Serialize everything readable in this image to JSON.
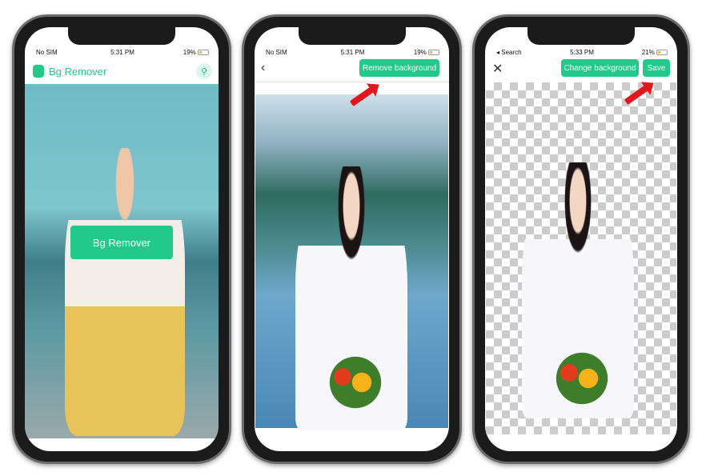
{
  "accent_color": "#22c98a",
  "phones": [
    {
      "status": {
        "carrier": "No SIM",
        "time": "5:31 PM",
        "battery": "19%"
      },
      "app_title": "Bg Remover",
      "cta_label": "Bg Remover"
    },
    {
      "status": {
        "carrier": "No SIM",
        "time": "5:31 PM",
        "battery": "19%"
      },
      "action_label": "Remove background"
    },
    {
      "status": {
        "carrier": "◂ Search",
        "time": "5:33 PM",
        "battery": "21%"
      },
      "change_label": "Change background",
      "save_label": "Save"
    }
  ]
}
